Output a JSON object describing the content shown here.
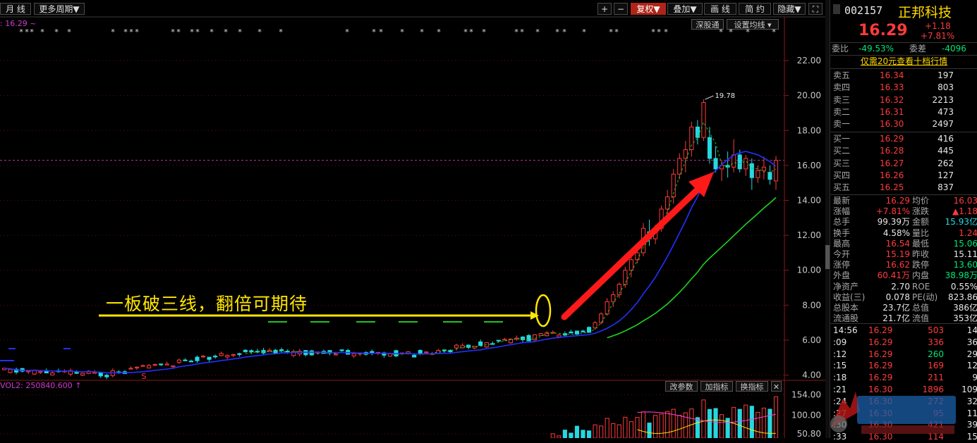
{
  "toolbar": {
    "period_label": "月 线",
    "multi_period_label": "更多周期",
    "plus_label": "+",
    "minus_label": "−",
    "adjust_label": "复权",
    "overlay_label": "叠加",
    "draw_label": "画 线",
    "simple_label": "简 约",
    "hide_label": "隐藏"
  },
  "chart_header": {
    "ma_value": "16.29",
    "sub_tab_1": "深股通",
    "sub_tab_2": "设置均线"
  },
  "annotations": {
    "main_text": "一板破三线，翻倍可期待",
    "high_label": "19.78",
    "s_marker": "S"
  },
  "volume_panel": {
    "label": "VOL2: 250840.600",
    "btn_params": "改参数",
    "btn_add": "加指标",
    "btn_switch": "换指标"
  },
  "colors": {
    "up": "#ff3b3b",
    "down": "#27d7e0",
    "ma_blue": "#2230ff",
    "ma_green": "#1ed41e",
    "yellow": "#ffe600",
    "dashed_green": "#22c422"
  },
  "chart_data": {
    "type": "candlestick",
    "period": "monthly",
    "price_axis": {
      "ticks": [
        "22.00",
        "20.00",
        "18.00",
        "16.00",
        "14.00",
        "12.00",
        "10.00",
        "8.00",
        "6.00",
        "4.00"
      ],
      "range": [
        3.7,
        24.5
      ]
    },
    "volume_axis": {
      "ticks": [
        "154.00",
        "100.00",
        "50.80"
      ],
      "range": [
        40,
        170
      ]
    },
    "last_close": 16.29,
    "high_point": 19.78
  },
  "quote": {
    "code": "002157",
    "name": "正邦科技",
    "price": "16.29",
    "change": "+1.18",
    "change_pct": "+7.81%",
    "webi_label": "委比",
    "webi_value": "-49.53%",
    "weicha_label": "委差",
    "weicha_value": "-4096",
    "promo": "仅需20元查看十档行情",
    "asks": [
      {
        "label": "卖五",
        "price": "16.34",
        "vol": "197"
      },
      {
        "label": "卖四",
        "price": "16.33",
        "vol": "803"
      },
      {
        "label": "卖三",
        "price": "16.32",
        "vol": "2213"
      },
      {
        "label": "卖二",
        "price": "16.31",
        "vol": "473"
      },
      {
        "label": "卖一",
        "price": "16.30",
        "vol": "2497"
      }
    ],
    "bids": [
      {
        "label": "买一",
        "price": "16.29",
        "vol": "416"
      },
      {
        "label": "买二",
        "price": "16.28",
        "vol": "445"
      },
      {
        "label": "买三",
        "price": "16.27",
        "vol": "262"
      },
      {
        "label": "买四",
        "price": "16.26",
        "vol": "127"
      },
      {
        "label": "买五",
        "price": "16.25",
        "vol": "837"
      }
    ],
    "stats": [
      {
        "l1": "最新",
        "v1": "16.29",
        "c1": "c-red",
        "l2": "均价",
        "v2": "16.03",
        "c2": "c-red"
      },
      {
        "l1": "涨幅",
        "v1": "+7.81%",
        "c1": "c-red",
        "l2": "涨跌",
        "v2": "▲1.18",
        "c2": "c-red"
      },
      {
        "l1": "总手",
        "v1": "99.39万",
        "c1": "c-white",
        "l2": "金额",
        "v2": "15.93亿",
        "c2": "c-cyan"
      },
      {
        "l1": "换手",
        "v1": "4.58%",
        "c1": "c-white",
        "l2": "量比",
        "v2": "1.24",
        "c2": "c-red"
      },
      {
        "l1": "最高",
        "v1": "16.54",
        "c1": "c-red",
        "l2": "最低",
        "v2": "15.06",
        "c2": "c-green"
      },
      {
        "l1": "今开",
        "v1": "15.19",
        "c1": "c-red",
        "l2": "昨收",
        "v2": "15.11",
        "c2": "c-white"
      },
      {
        "l1": "涨停",
        "v1": "16.62",
        "c1": "c-red",
        "l2": "跌停",
        "v2": "13.60",
        "c2": "c-green"
      },
      {
        "l1": "外盘",
        "v1": "60.41万",
        "c1": "c-red",
        "l2": "内盘",
        "v2": "38.98万",
        "c2": "c-green"
      },
      {
        "l1": "净资产",
        "v1": "2.70",
        "c1": "c-white",
        "l2": "ROE",
        "v2": "0.55%",
        "c2": "c-white"
      },
      {
        "l1": "收益(三)",
        "v1": "0.078",
        "c1": "c-white",
        "l2": "PE(动)",
        "v2": "823.86",
        "c2": "c-white"
      },
      {
        "l1": "总股本",
        "v1": "23.7亿",
        "c1": "c-white",
        "l2": "总值",
        "v2": "386亿",
        "c2": "c-white"
      },
      {
        "l1": "流通股",
        "v1": "21.7亿",
        "c1": "c-white",
        "l2": "流值",
        "v2": "353亿",
        "c2": "c-white"
      }
    ],
    "ticks": [
      {
        "time": "14:56",
        "price": "16.29",
        "vol": "503",
        "n": "14"
      },
      {
        "time": ":09",
        "price": "16.29",
        "vol": "336",
        "n": "36"
      },
      {
        "time": ":12",
        "price": "16.29",
        "vol": "260",
        "n": "29"
      },
      {
        "time": ":15",
        "price": "16.29",
        "vol": "169",
        "n": "12"
      },
      {
        "time": ":18",
        "price": "16.29",
        "vol": "211",
        "n": "9"
      },
      {
        "time": ":21",
        "price": "16.30",
        "vol": "1896",
        "n": "109"
      },
      {
        "time": ":24",
        "price": "16.30",
        "vol": "272",
        "n": "32"
      },
      {
        "time": ":27",
        "price": "16.30",
        "vol": "95",
        "n": "11"
      },
      {
        "time": ":30",
        "price": "16.30",
        "vol": "421",
        "n": "39"
      },
      {
        "time": ":33",
        "price": "16.30",
        "vol": "114",
        "n": "15"
      }
    ]
  }
}
